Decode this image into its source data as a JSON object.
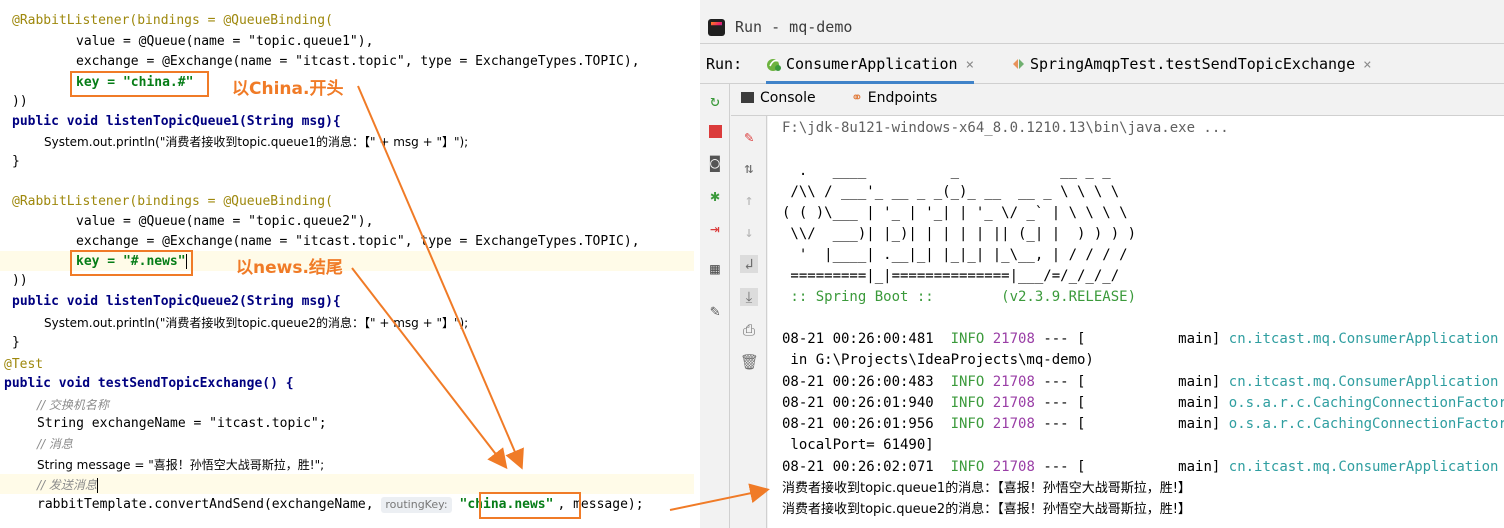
{
  "editor": {
    "lines": [
      [
        "@RabbitListener(bindings = @QueueBinding("
      ],
      [
        "value = @Queue(name = \"topic.queue1\"),"
      ],
      [
        "exchange = @Exchange(name = \"itcast.topic\", type = ExchangeTypes.TOPIC),"
      ],
      [
        "key = \"china.#\""
      ],
      [
        "))"
      ],
      [
        "public void listenTopicQueue1(String msg){"
      ],
      [
        "System.out.println(\"消费者接收到topic.queue1的消息：【\" + msg + \"】\");"
      ],
      [
        "}"
      ],
      [
        "@RabbitListener(bindings = @QueueBinding("
      ],
      [
        "value = @Queue(name = \"topic.queue2\"),"
      ],
      [
        "exchange = @Exchange(name = \"itcast.topic\", type = ExchangeTypes.TOPIC),"
      ],
      [
        "key = \"#.news\""
      ],
      [
        "))"
      ],
      [
        "public void listenTopicQueue2(String msg){"
      ],
      [
        "System.out.println(\"消费者接收到topic.queue2的消息：【\" + msg + \"】\");"
      ],
      [
        "}"
      ],
      [
        "@Test"
      ],
      [
        "public void testSendTopicExchange() {"
      ],
      [
        "// 交换机名称"
      ],
      [
        "String exchangeName = \"itcast.topic\";"
      ],
      [
        "// 消息"
      ],
      [
        "String message = \"喜报！孙悟空大战哥斯拉，胜!\";"
      ],
      [
        "// 发送消息"
      ],
      [
        "rabbitTemplate.convertAndSend(exchangeName, ",
        "routingKey:",
        "\"china.news\"",
        ", message);"
      ]
    ],
    "callouts": {
      "china": "以China.开头",
      "news": "以news.结尾"
    }
  },
  "run": {
    "title": "Run - mq-demo",
    "run_label": "Run:",
    "tabs": [
      {
        "label": "ConsumerApplication",
        "active": true
      },
      {
        "label": "SpringAmqpTest.testSendTopicExchange",
        "active": false
      }
    ],
    "close_glyph": "×",
    "subtabs": [
      {
        "label": "Console",
        "icon": "console-icon"
      },
      {
        "label": "Endpoints",
        "icon": "endpoints-icon"
      }
    ],
    "console": {
      "java_cmd": "F:\\jdk-8u121-windows-x64_8.0.1210.13\\bin\\java.exe ...",
      "banner": [
        "  .   ____          _            __ _ _",
        " /\\\\ / ___'_ __ _ _(_)_ __  __ _ \\ \\ \\ \\",
        "( ( )\\___ | '_ | '_| | '_ \\/ _` | \\ \\ \\ \\",
        " \\\\/  ___)| |_)| | | | | || (_| |  ) ) ) )",
        "  '  |____| .__|_| |_|_| |_\\__, | / / / /",
        " =========|_|==============|___/=/_/_/_/"
      ],
      "spring_boot": " :: Spring Boot ::        (v2.3.9.RELEASE)",
      "logs": [
        {
          "ts": "08-21 00:26:00:481",
          "level": "INFO",
          "pid": "21708",
          "mid": " --- [           main] ",
          "cls": "cn.itcast.mq.ConsumerApplication"
        },
        {
          "cont": " in G:\\Projects\\IdeaProjects\\mq-demo)"
        },
        {
          "ts": "08-21 00:26:00:483",
          "level": "INFO",
          "pid": "21708",
          "mid": " --- [           main] ",
          "cls": "cn.itcast.mq.ConsumerApplication"
        },
        {
          "ts": "08-21 00:26:01:940",
          "level": "INFO",
          "pid": "21708",
          "mid": " --- [           main] ",
          "cls": "o.s.a.r.c.CachingConnectionFactory"
        },
        {
          "ts": "08-21 00:26:01:956",
          "level": "INFO",
          "pid": "21708",
          "mid": " --- [           main] ",
          "cls": "o.s.a.r.c.CachingConnectionFactory"
        },
        {
          "cont": " localPort= 61490]"
        },
        {
          "ts": "08-21 00:26:02:071",
          "level": "INFO",
          "pid": "21708",
          "mid": " --- [           main] ",
          "cls": "cn.itcast.mq.ConsumerApplication"
        }
      ],
      "messages": [
        "消费者接收到topic.queue1的消息：【喜报！孙悟空大战哥斯拉，胜!】",
        "消费者接收到topic.queue2的消息：【喜报！孙悟空大战哥斯拉，胜!】"
      ]
    }
  },
  "colors": {
    "accent_orange": "#f07b27",
    "annotation": "#9e880d",
    "keyword": "#000080",
    "string": "#067d17",
    "info_green": "#3b9a3b",
    "pid_magenta": "#9a3ea6",
    "class_teal": "#2f9ea0",
    "tab_underline": "#4083c9"
  }
}
